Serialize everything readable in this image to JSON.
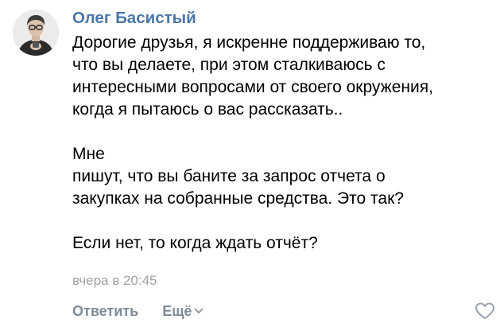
{
  "comment": {
    "author": "Олег Басистый",
    "avatar_icon": "user-photo-avatar",
    "lines": [
      "Дорогие друзья, я искренне поддерживаю то,",
      "что вы делаете, при этом сталкиваюсь с",
      "интересными вопросами от своего окружения,",
      "когда я пытаюсь о вас рассказать..",
      "",
      "Мне",
      "пишут, что вы баните за запрос отчета о",
      "закупках на собранные средства. Это так?",
      "",
      "Если нет, то когда ждать отчёт?"
    ],
    "timestamp": "вчера в 20:45"
  },
  "actions": {
    "reply_label": "Ответить",
    "more_label": "Ещё",
    "more_icon": "chevron-down-icon",
    "like_icon": "heart-outline-icon"
  },
  "colors": {
    "author": "#4a76a8",
    "text": "#000000",
    "timestamp": "#a0a3a8",
    "actions": "#828b96"
  }
}
